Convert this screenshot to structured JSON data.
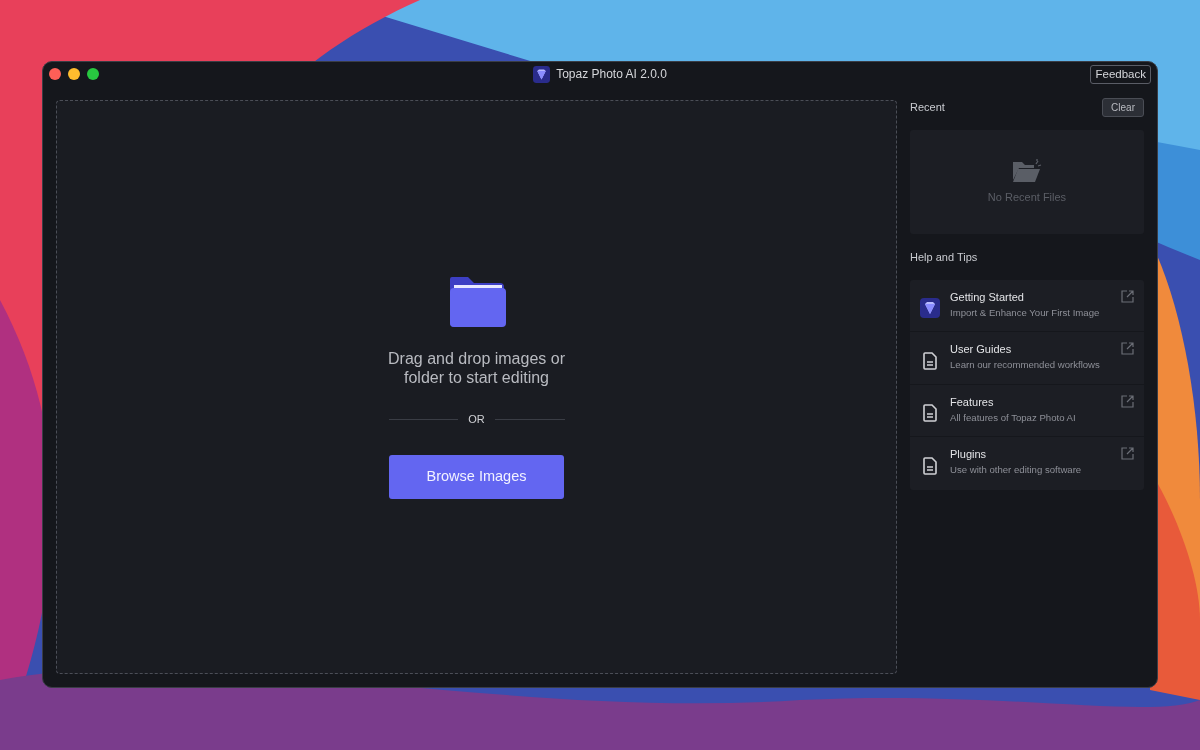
{
  "window": {
    "title": "Topaz Photo AI 2.0.0",
    "feedback": "Feedback"
  },
  "dropzone": {
    "message": "Drag and drop images or folder to start editing",
    "separator": "OR",
    "button": "Browse Images"
  },
  "recent": {
    "title": "Recent",
    "clear": "Clear",
    "empty": "No Recent Files"
  },
  "help": {
    "title": "Help and Tips",
    "items": [
      {
        "kind": "app",
        "title": "Getting Started",
        "subtitle": "Import & Enhance Your First Image"
      },
      {
        "kind": "doc",
        "title": "User Guides",
        "subtitle": "Learn our recommended workflows"
      },
      {
        "kind": "doc",
        "title": "Features",
        "subtitle": "All features of Topaz Photo AI"
      },
      {
        "kind": "doc",
        "title": "Plugins",
        "subtitle": "Use with other editing software"
      }
    ]
  }
}
